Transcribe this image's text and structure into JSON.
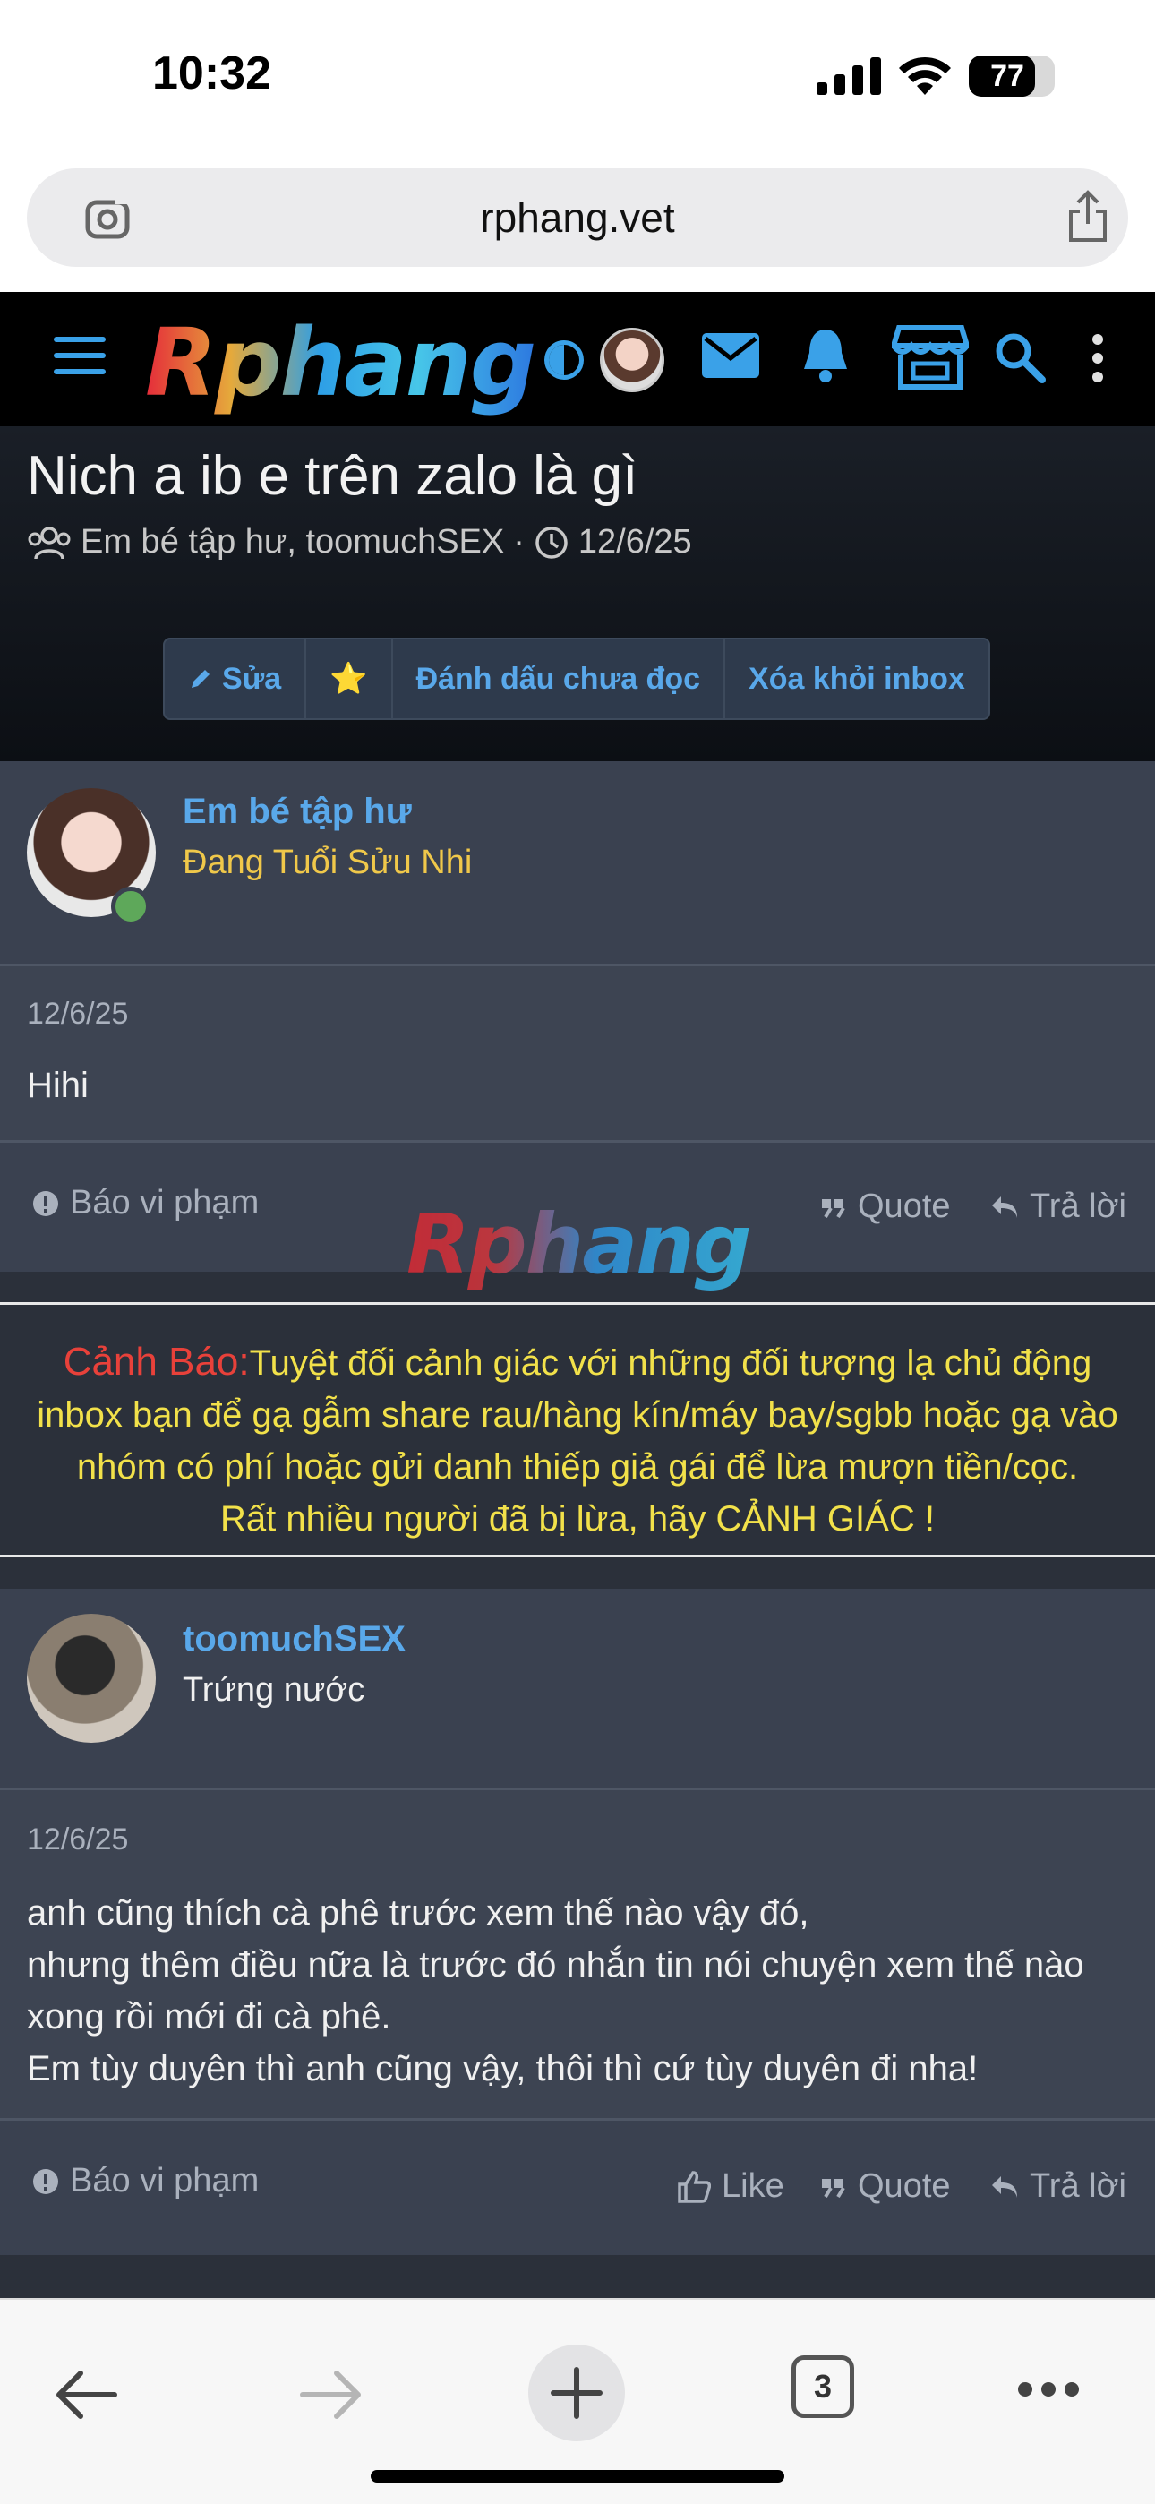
{
  "status_bar": {
    "time": "10:32",
    "battery": "77",
    "battery_level": 0.77
  },
  "browser": {
    "url": "rphang.vet"
  },
  "site": {
    "logo": "Rphang",
    "accent": "#3aa1e8"
  },
  "thread": {
    "title": "Nich a ib e trên zalo là gì",
    "participants": "Em bé tập hư, toomuchSEX",
    "separator": "·",
    "date": "12/6/25",
    "buttons": {
      "edit": "Sửa",
      "star": "⭐",
      "mark_unread": "Đánh dấu chưa đọc",
      "remove_inbox": "Xóa khỏi inbox"
    }
  },
  "posts": [
    {
      "username": "Em bé tập hư",
      "user_title": "Đang Tuổi Sửu Nhi",
      "user_title_color": "#f0c84a",
      "date": "12/6/25",
      "lines": [
        "Hihi"
      ],
      "report": "Báo vi phạm",
      "quote": "Quote",
      "reply": "Trả lời"
    },
    {
      "username": "toomuchSEX",
      "user_title": "Trứng nước",
      "user_title_color": "#f0f0f0",
      "date": "12/6/25",
      "lines": [
        "anh cũng thích cà phê trước xem thế nào vậy đó,",
        "nhưng thêm điều nữa là trước đó nhắn tin nói chuyện xem thế nào",
        "xong rồi mới đi cà phê.",
        "Em tùy duyên thì anh cũng vậy, thôi thì cứ tùy duyên đi nha!"
      ],
      "report": "Báo vi phạm",
      "like": "Like",
      "quote": "Quote",
      "reply": "Trả lời"
    }
  ],
  "warning": {
    "label": "Cảnh Báo:",
    "line1": "Tuyệt đối cảnh giác với những đối tượng lạ chủ động",
    "line2": "inbox bạn để gạ gẫm share rau/hàng kín/máy bay/sgbb hoặc gạ vào",
    "line3": "nhóm có phí hoặc gửi danh thiếp giả gái để lừa mượn tiền/cọc.",
    "line4": "Rất nhiều người đã bị lừa, hãy CẢNH GIÁC !"
  },
  "watermark": "Rphang",
  "toolbar": {
    "tab_count": "3"
  }
}
